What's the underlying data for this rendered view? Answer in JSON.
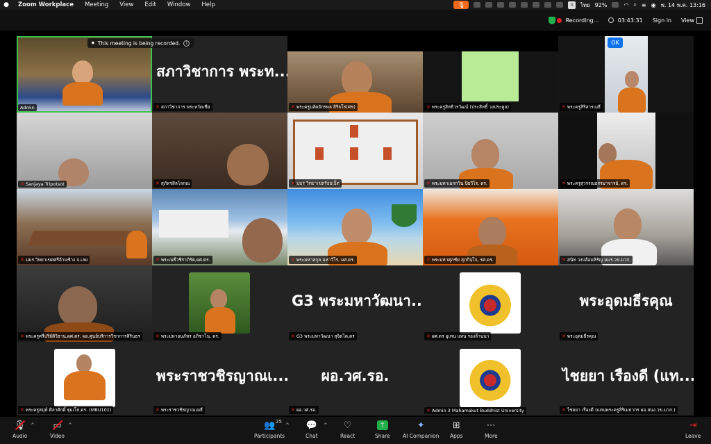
{
  "menubar": {
    "app_name": "Zoom Workplace",
    "items": [
      "Meeting",
      "View",
      "Edit",
      "Window",
      "Help"
    ],
    "battery": "92%",
    "input_lang": "ก",
    "lang_label": "ไทย",
    "datetime": "พ. 14 พ.ค.  13:16"
  },
  "topbar": {
    "recording_label": "Recording...",
    "timer": "03:43:31",
    "sign_in": "Sign in",
    "view": "View"
  },
  "banner": {
    "text": "This meeting is being recorded.",
    "ok": "OK"
  },
  "tiles": [
    {
      "name": "Admin",
      "muted": false
    },
    {
      "name": "สภาวิชาการ พระหวัดเชีย",
      "big": "สภาวิชาการ พระท...",
      "muted": true
    },
    {
      "name": "พระครูบลัดจักรพล สิริธโร(ศข)",
      "muted": true
    },
    {
      "name": "พระครูสิทธิวรวัฒน์ (ประสิทธิ์ วงประดูล)",
      "muted": true
    },
    {
      "name": "พระครูสิริสารเมธี",
      "muted": true
    },
    {
      "name": "Sanjaya Tripotsot",
      "muted": true
    },
    {
      "name": "สุภัทรสิลโลกณ",
      "muted": true
    },
    {
      "name": "มมร วิทยาเขตร้อยเอ็ด",
      "muted": true
    },
    {
      "name": "พระมหาเอกกวิน ปิยวีโร, ดร.",
      "muted": true
    },
    {
      "name": "พระครูสุวรรณธรรมาจารย์, ดร.",
      "muted": true
    },
    {
      "name": "มมร.วิทยาเขตศรีล้านช้าง จ.เลย",
      "muted": true
    },
    {
      "name": "พระเมธีวชิราภิรัต,ผศ.ดร.",
      "muted": true
    },
    {
      "name": "พระมหาสกุล มหาวีโร, ผศ.ดร.",
      "muted": true
    },
    {
      "name": "พระมหาศุภชัย สุภกิจฺโจ, รศ.ดร.",
      "muted": true
    },
    {
      "name": "สนิท วงปล้อมหิรัญ มมร.วข.มวก.",
      "muted": true
    },
    {
      "name": "พระครูศรีปริยัติวิธาน,ผศ.ดร. ผอ.ศูนย์บริการวิชาการสิรินธร",
      "muted": true
    },
    {
      "name": "พระมหาอนภัทร อภิชาโน, ดร.",
      "muted": true
    },
    {
      "name": "G3 พระมหาวัฒนา สุจิตโต,ดร",
      "big": "G3 พระมหาวัฒนา...",
      "muted": true
    },
    {
      "name": "ผศ.ดร อุเทน แทน รองล้านนา",
      "muted": true
    },
    {
      "name": "พระอุดมธีรคุณ",
      "big": "พระอุดมธีรคุณ",
      "muted": true
    },
    {
      "name": "พระครูสมุห์ ศิลาศักดิ์ ฐุมเโธ,ดร. (MBU101)",
      "muted": true
    },
    {
      "name": "พระราชวชิรญาณเมธี",
      "big": "พระราชวชิรญาณเ...",
      "muted": true
    },
    {
      "name": "ผอ.วศ.รอ.",
      "big": "ผอ.วศ.รอ.",
      "muted": true
    },
    {
      "name": "Admin 3 Mahamakut Buddhist University",
      "muted": true
    },
    {
      "name": "ไชยยา เรืองดี (แทนพระครูสิริเมธากร ผอ.สนง.วข.มวก.)",
      "big": "ไชยยา เรืองดี (แท...",
      "muted": true
    }
  ],
  "toolbar": {
    "audio": "Audio",
    "video": "Video",
    "participants": "Participants",
    "participants_count": "25",
    "chat": "Chat",
    "react": "React",
    "share": "Share",
    "ai": "AI Companion",
    "apps": "Apps",
    "more": "More",
    "leave": "Leave"
  },
  "colors": {
    "accent": "#0e72ed",
    "share_green": "#22b04a",
    "muted_red": "#e02424",
    "recording_orange": "#f26b1d"
  }
}
